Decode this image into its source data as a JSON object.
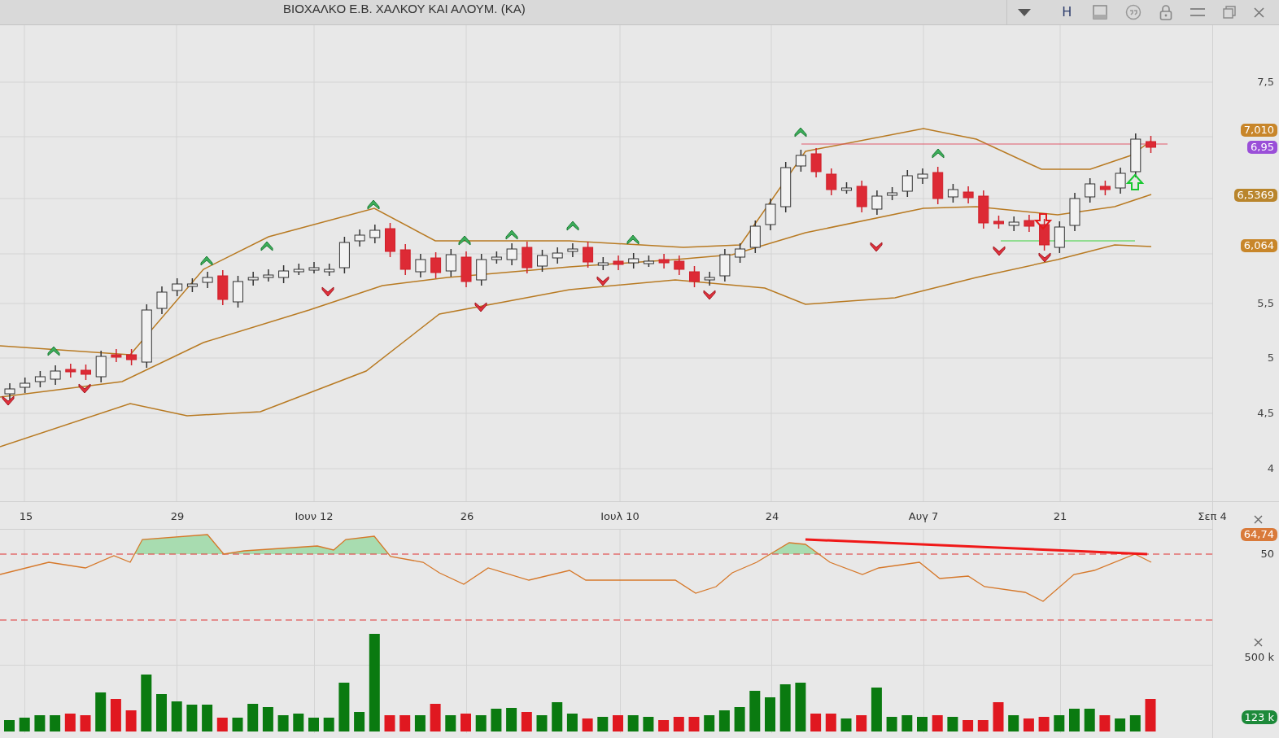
{
  "title_bar": {
    "title": "ΒΙΟΧΑΛΚΟ Ε.Β. ΧΑΛΚΟΥ  ΚΑΙ  ΑΛΟΥΜ. (ΚΑ)",
    "mode_label": "H"
  },
  "price_panel": {
    "y_axis_labels": [
      "7,5",
      "5,5",
      "5",
      "4,5",
      "4"
    ],
    "price_tags": [
      {
        "text": "7,010",
        "color": "#c8862a"
      },
      {
        "text": "6,95",
        "color": "#9a4fd8"
      },
      {
        "text": "6,5369",
        "color": "#b9852c"
      },
      {
        "text": "6,064",
        "color": "#c8862a"
      }
    ]
  },
  "x_axis_labels": [
    "15",
    "29",
    "Ιουν 12",
    "26",
    "Ιουλ 10",
    "24",
    "Αυγ 7",
    "21",
    "Σεπ 4"
  ],
  "rsi_panel": {
    "value_tag": "64,74",
    "axis_label": "50"
  },
  "volume_panel": {
    "axis_label": "500 k",
    "value_tag": "123 k"
  }
}
